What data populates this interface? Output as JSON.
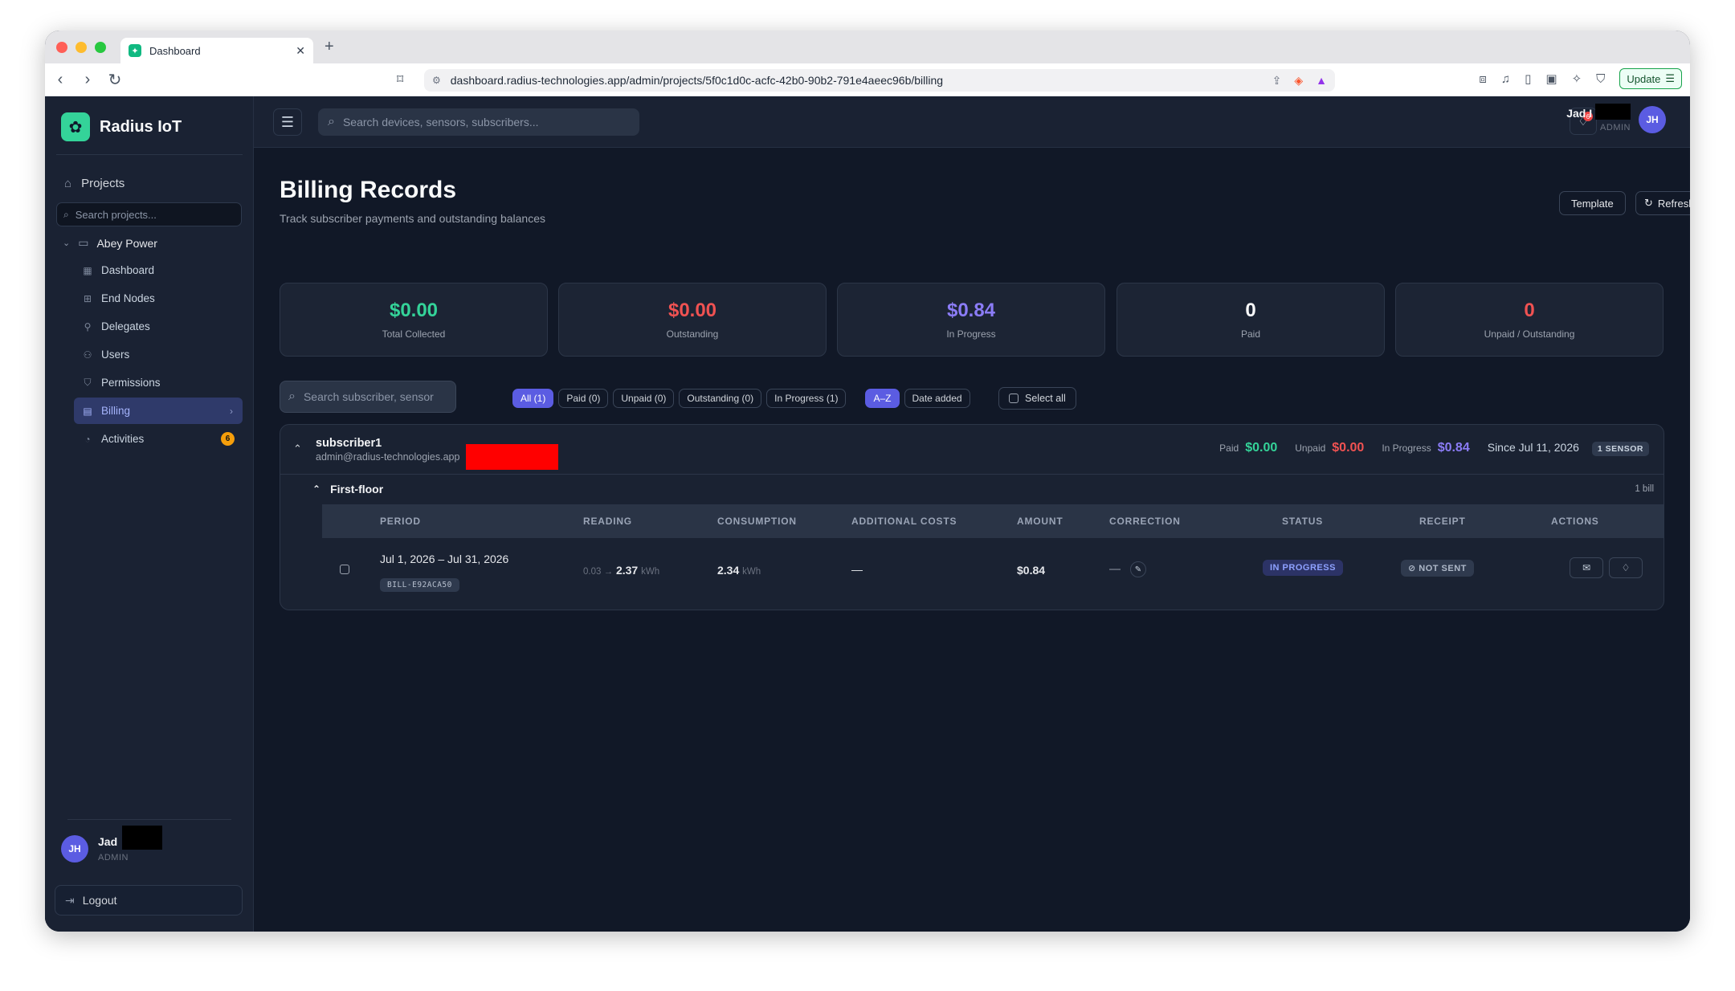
{
  "browser": {
    "tab_title": "Dashboard",
    "url": "dashboard.radius-technologies.app/admin/projects/5f0c1d0c-acfc-42b0-90b2-791e4aeec96b/billing",
    "update_label": "Update"
  },
  "sidebar": {
    "brand": "Radius IoT",
    "projects_label": "Projects",
    "search_placeholder": "Search projects...",
    "project_name": "Abey Power",
    "items": [
      {
        "label": "Dashboard",
        "icon": "grid-icon"
      },
      {
        "label": "End Nodes",
        "icon": "chip-icon"
      },
      {
        "label": "Delegates",
        "icon": "user-key-icon"
      },
      {
        "label": "Users",
        "icon": "users-icon"
      },
      {
        "label": "Permissions",
        "icon": "shield-icon"
      },
      {
        "label": "Billing",
        "icon": "receipt-icon",
        "active": true
      },
      {
        "label": "Activities",
        "icon": "bell-icon",
        "badge": "6"
      }
    ],
    "user": {
      "initials": "JH",
      "name": "Jad",
      "role": "ADMIN"
    },
    "logout_label": "Logout"
  },
  "header": {
    "search_placeholder": "Search devices, sensors, subscribers...",
    "notification_count": "6",
    "user_name": "Jad I",
    "user_role": "ADMIN",
    "user_initials": "JH"
  },
  "page": {
    "title": "Billing Records",
    "subtitle": "Track subscriber payments and outstanding balances",
    "template_label": "Template",
    "refresh_label": "Refresh"
  },
  "stats": [
    {
      "value": "$0.00",
      "label": "Total Collected",
      "color": "#34d399"
    },
    {
      "value": "$0.00",
      "label": "Outstanding",
      "color": "#f05252"
    },
    {
      "value": "$0.84",
      "label": "In Progress",
      "color": "#8b7cf6"
    },
    {
      "value": "0",
      "label": "Paid",
      "color": "#f9fafb"
    },
    {
      "value": "0",
      "label": "Unpaid / Outstanding",
      "color": "#f05252"
    }
  ],
  "filters": {
    "search_placeholder": "Search subscriber, sensor",
    "status_chips": [
      "All (1)",
      "Paid (0)",
      "Unpaid (0)",
      "Outstanding (0)",
      "In Progress (1)"
    ],
    "sort_chips": [
      "A–Z",
      "Date added"
    ],
    "select_all_label": "Select all"
  },
  "subscriber": {
    "name": "subscriber1",
    "email": "admin@radius-technologies.app",
    "paid_label": "Paid",
    "paid_value": "$0.00",
    "unpaid_label": "Unpaid",
    "unpaid_value": "$0.00",
    "progress_label": "In Progress",
    "progress_value": "$0.84",
    "since": "Since Jul 11, 2026",
    "sensor_badge": "1 SENSOR",
    "floor": "First-floor",
    "bill_count": "1 bill",
    "columns": [
      "PERIOD",
      "READING",
      "CONSUMPTION",
      "ADDITIONAL COSTS",
      "AMOUNT",
      "CORRECTION",
      "STATUS",
      "RECEIPT",
      "ACTIONS"
    ],
    "row": {
      "period": "Jul 1, 2026 – Jul 31, 2026",
      "bill_id": "BILL-E92ACA50",
      "reading_from": "0.03 →",
      "reading_to": "2.37",
      "reading_unit": "kWh",
      "consumption": "2.34",
      "consumption_unit": "kWh",
      "additional_costs": "—",
      "amount": "$0.84",
      "correction": "—",
      "status": "IN PROGRESS",
      "receipt": "NOT SENT"
    }
  }
}
